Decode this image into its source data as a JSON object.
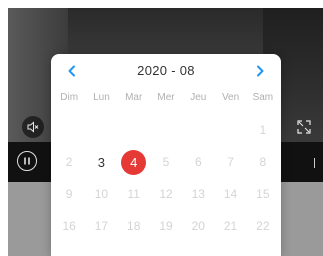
{
  "colors": {
    "accent": "#2196f3",
    "selected_day": "#e53935",
    "active_day_text": "#333333",
    "inactive_day_text": "#d4d4d4"
  },
  "player": {
    "mute_icon": "speaker-muted-icon",
    "fullscreen_icon": "fullscreen-icon",
    "pause_icon": "pause-icon"
  },
  "calendar": {
    "title": "2020 - 08",
    "prev_icon": "chevron-left-icon",
    "next_icon": "chevron-right-icon",
    "weekdays": [
      "Dim",
      "Lun",
      "Mar",
      "Mer",
      "Jeu",
      "Ven",
      "Sam"
    ],
    "weeks": [
      [
        "",
        "",
        "",
        "",
        "",
        "",
        "1"
      ],
      [
        "2",
        "3",
        "4",
        "5",
        "6",
        "7",
        "8"
      ],
      [
        "9",
        "10",
        "11",
        "12",
        "13",
        "14",
        "15"
      ],
      [
        "16",
        "17",
        "18",
        "19",
        "20",
        "21",
        "22"
      ]
    ],
    "active_days": [
      "3",
      "4"
    ],
    "selected_day": "4"
  }
}
